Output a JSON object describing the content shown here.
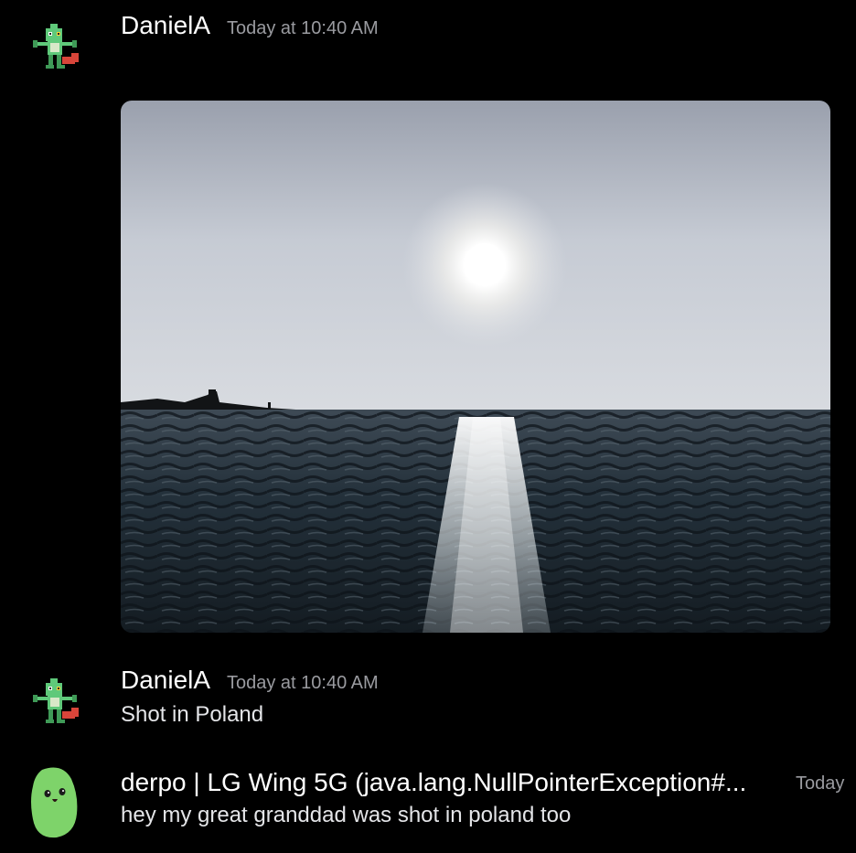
{
  "messages": [
    {
      "author": "DanielA",
      "timestamp": "Today at 10:40 AM",
      "avatar_icon": "green-lizard-pixel-icon",
      "attachment": {
        "type": "image",
        "subject": "sun over sea"
      }
    },
    {
      "author": "DanielA",
      "timestamp": "Today at 10:40 AM",
      "avatar_icon": "green-lizard-pixel-icon",
      "text": "Shot in Poland"
    },
    {
      "author": "derpo | LG Wing 5G (java.lang.NullPointerException#...",
      "timestamp": "Today",
      "avatar_icon": "green-bean-icon",
      "text": "hey my great granddad was shot in poland too"
    }
  ],
  "colors": {
    "background": "#000000",
    "username": "#ffffff",
    "timestamp": "#9a9ba0",
    "message_text": "#e4e5e8"
  }
}
